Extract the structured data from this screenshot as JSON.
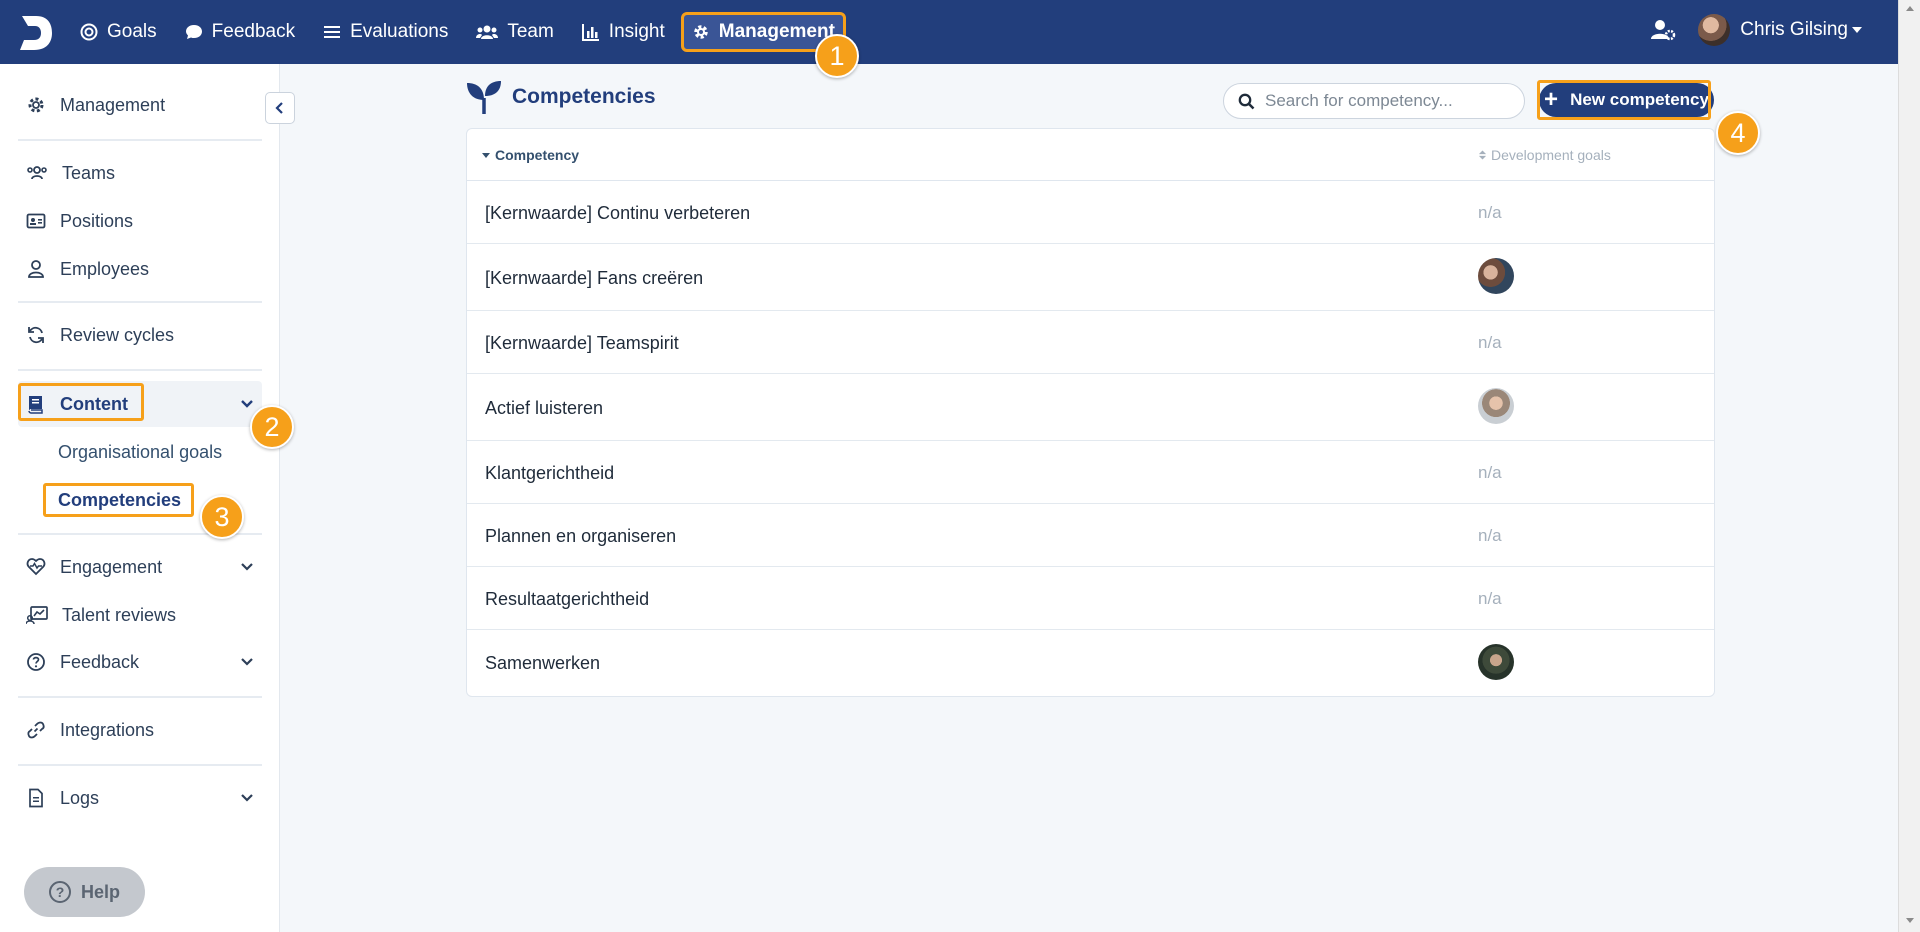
{
  "topbar": {
    "nav": [
      {
        "label": "Goals",
        "icon": "target-icon"
      },
      {
        "label": "Feedback",
        "icon": "chat-icon"
      },
      {
        "label": "Evaluations",
        "icon": "list-icon"
      },
      {
        "label": "Team",
        "icon": "users-icon"
      },
      {
        "label": "Insight",
        "icon": "bar-chart-icon"
      },
      {
        "label": "Management",
        "icon": "gear-icon",
        "active": true
      }
    ],
    "user_name": "Chris Gilsing"
  },
  "sidebar": {
    "management": "Management",
    "teams": "Teams",
    "positions": "Positions",
    "employees": "Employees",
    "review_cycles": "Review cycles",
    "content": "Content",
    "organisational_goals": "Organisational goals",
    "competencies": "Competencies",
    "engagement": "Engagement",
    "talent_reviews": "Talent reviews",
    "feedback": "Feedback",
    "integrations": "Integrations",
    "logs": "Logs",
    "help": "Help"
  },
  "page": {
    "title": "Competencies",
    "search_placeholder": "Search for competency...",
    "new_button": "New competency"
  },
  "table": {
    "col_competency": "Competency",
    "col_goals": "Development goals",
    "rows": [
      {
        "name": "[Kernwaarde] Continu verbeteren",
        "goals": "n/a"
      },
      {
        "name": "[Kernwaarde] Fans creëren",
        "goals": "avatar"
      },
      {
        "name": "[Kernwaarde] Teamspirit",
        "goals": "n/a"
      },
      {
        "name": "Actief luisteren",
        "goals": "avatar"
      },
      {
        "name": "Klantgerichtheid",
        "goals": "n/a"
      },
      {
        "name": "Plannen en organiseren",
        "goals": "n/a"
      },
      {
        "name": "Resultaatgerichtheid",
        "goals": "n/a"
      },
      {
        "name": "Samenwerken",
        "goals": "avatar"
      }
    ]
  },
  "badges": [
    "1",
    "2",
    "3",
    "4"
  ],
  "colors": {
    "brand": "#223e7c",
    "highlight": "#f6a01a"
  }
}
